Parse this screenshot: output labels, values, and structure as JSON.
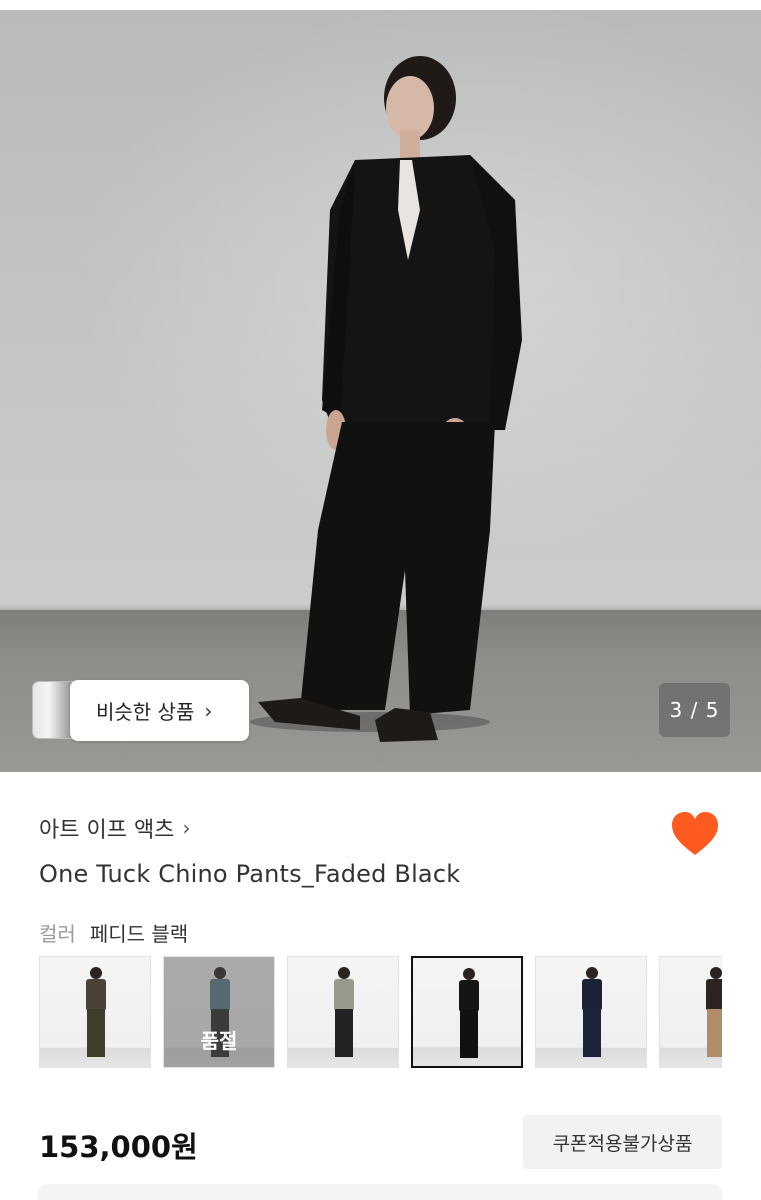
{
  "hero": {
    "similar_button_label": "비슷한 상품",
    "chevron": "›",
    "page_counter": "3 / 5"
  },
  "product": {
    "brand": "아트 이프 액츠",
    "brand_chevron": "›",
    "title": "One Tuck Chino Pants_Faded Black",
    "color_label": "컬러",
    "color_value": "페디드 블랙",
    "favorite_icon": "heart-icon",
    "favorite_color": "#FF5a1f",
    "swatches": [
      {
        "top": "#4a4236",
        "bottom": "#3f3d2c",
        "sold_out": false,
        "selected": false
      },
      {
        "top": "#5b7f8a",
        "bottom": "#2a2a2a",
        "sold_out": true,
        "sold_out_label": "품절",
        "selected": false
      },
      {
        "top": "#9a9a8c",
        "bottom": "#232323",
        "sold_out": false,
        "selected": false
      },
      {
        "top": "#151515",
        "bottom": "#111111",
        "sold_out": false,
        "selected": true
      },
      {
        "top": "#1b2236",
        "bottom": "#1d2438",
        "sold_out": false,
        "selected": false
      },
      {
        "top": "#2b2421",
        "bottom": "#b08d68",
        "sold_out": false,
        "selected": false
      }
    ],
    "price": "153,000원",
    "coupon_badge": "쿠폰적용불가상품"
  }
}
